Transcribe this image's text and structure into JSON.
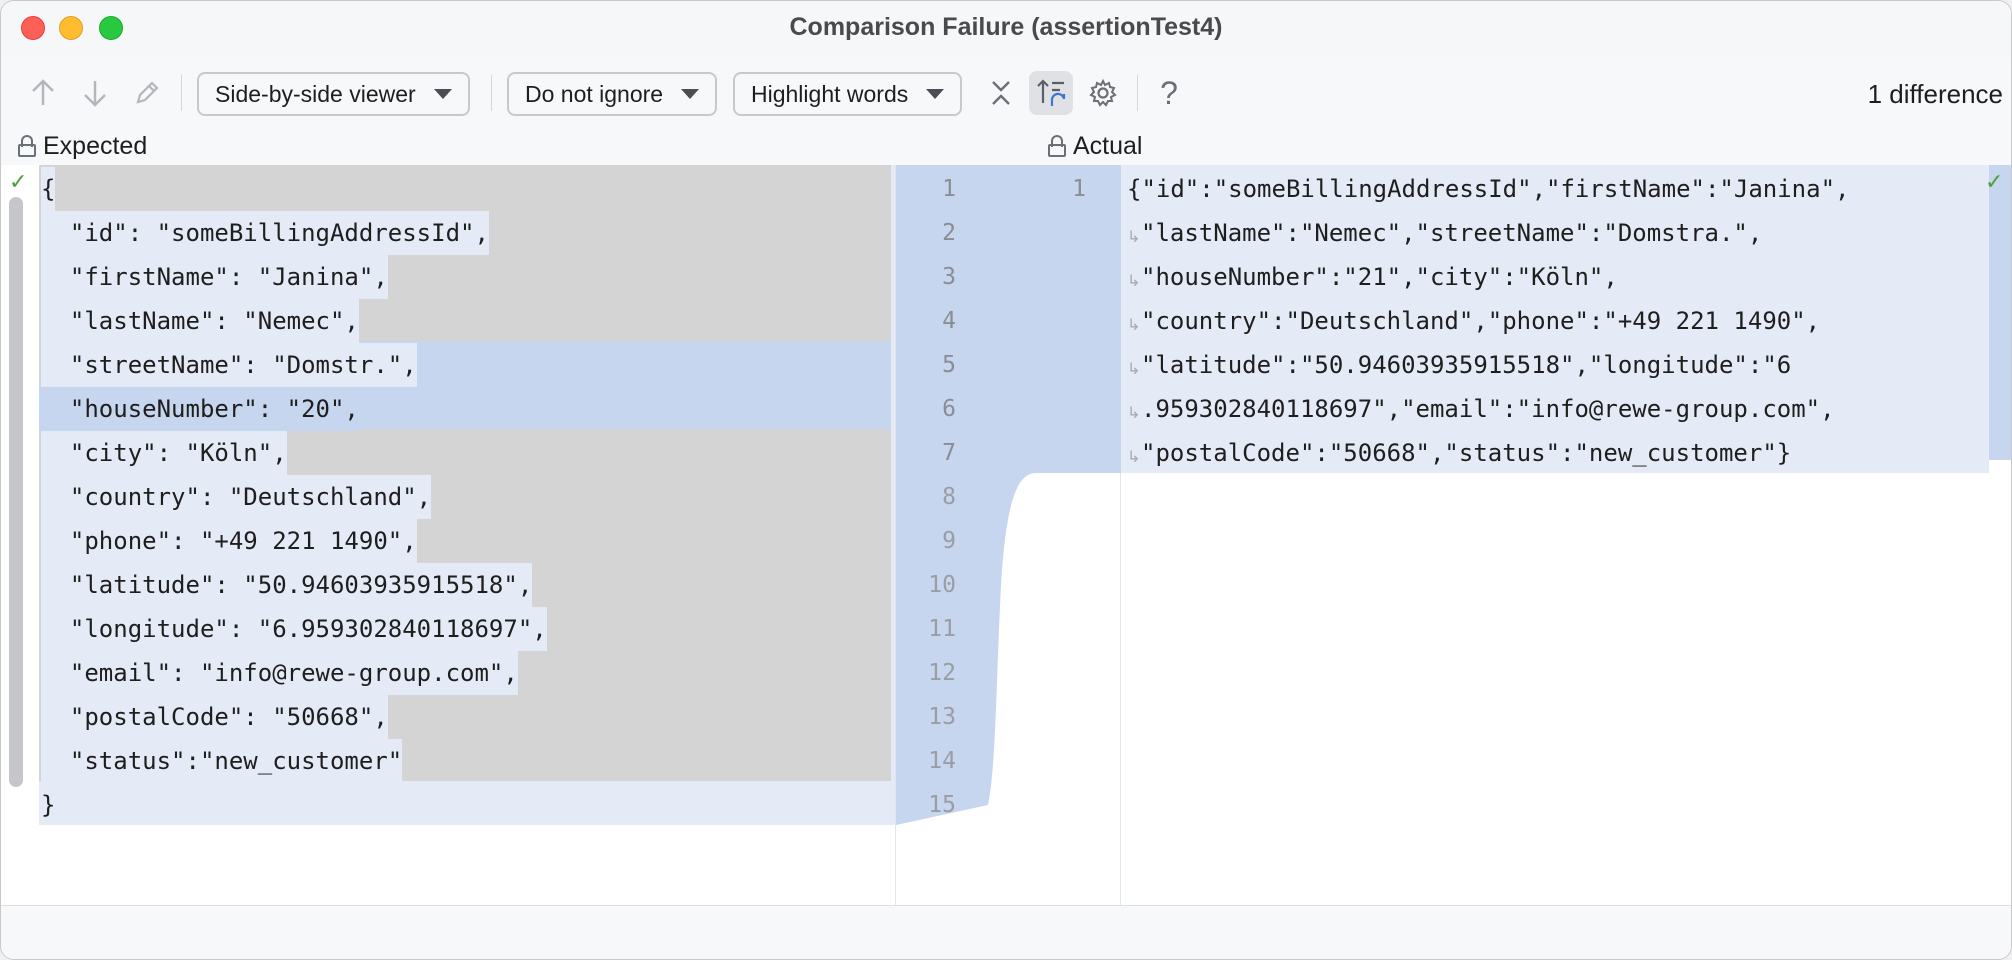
{
  "window": {
    "title": "Comparison Failure (assertionTest4)"
  },
  "toolbar": {
    "prev_icon": "arrow-up-icon",
    "next_icon": "arrow-down-icon",
    "edit_icon": "pencil-icon",
    "viewer_label": "Side-by-side viewer",
    "ignore_label": "Do not ignore",
    "highlight_label": "Highlight words",
    "collapse_icon": "collapse-icon",
    "sync_scroll_icon": "sync-scroll-icon",
    "settings_icon": "gear-icon",
    "help_label": "?",
    "difference_count": "1 difference"
  },
  "expected": {
    "header": "Expected",
    "lines": [
      "{",
      "  \"id\": \"someBillingAddressId\",",
      "  \"firstName\": \"Janina\",",
      "  \"lastName\": \"Nemec\",",
      "  \"streetName\": \"Domstr.\",",
      "  \"houseNumber\": \"20\",",
      "  \"city\": \"Köln\",",
      "  \"country\": \"Deutschland\",",
      "  \"phone\": \"+49 221 1490\",",
      "  \"latitude\": \"50.94603935915518\",",
      "  \"longitude\": \"6.959302840118697\",",
      "  \"email\": \"info@rewe-group.com\",",
      "  \"postalCode\": \"50668\",",
      "  \"status\":\"new_customer\"",
      "}"
    ]
  },
  "gutter": {
    "left_numbers": [
      "1",
      "2",
      "3",
      "4",
      "5",
      "6",
      "7",
      "8",
      "9",
      "10",
      "11",
      "12",
      "13",
      "14",
      "15"
    ],
    "right_numbers": [
      "1"
    ]
  },
  "actual": {
    "header": "Actual",
    "lines": [
      "{\"id\":\"someBillingAddressId\",\"firstName\":\"Janina\",",
      "\"lastName\":\"Nemec\",\"streetName\":\"Domstra.\",",
      "\"houseNumber\":\"21\",\"city\":\"Köln\",",
      "\"country\":\"Deutschland\",\"phone\":\"+49 221 1490\",",
      "\"latitude\":\"50.94603935915518\",\"longitude\":\"6",
      ".959302840118697\",\"email\":\"info@rewe-group.com\",",
      "\"postalCode\":\"50668\",\"status\":\"new_customer\"}"
    ]
  },
  "colors": {
    "changed_block": "#c6d6ee",
    "whitespace_diff": "#d4d4d4",
    "inserted": "#c9e6c3"
  }
}
